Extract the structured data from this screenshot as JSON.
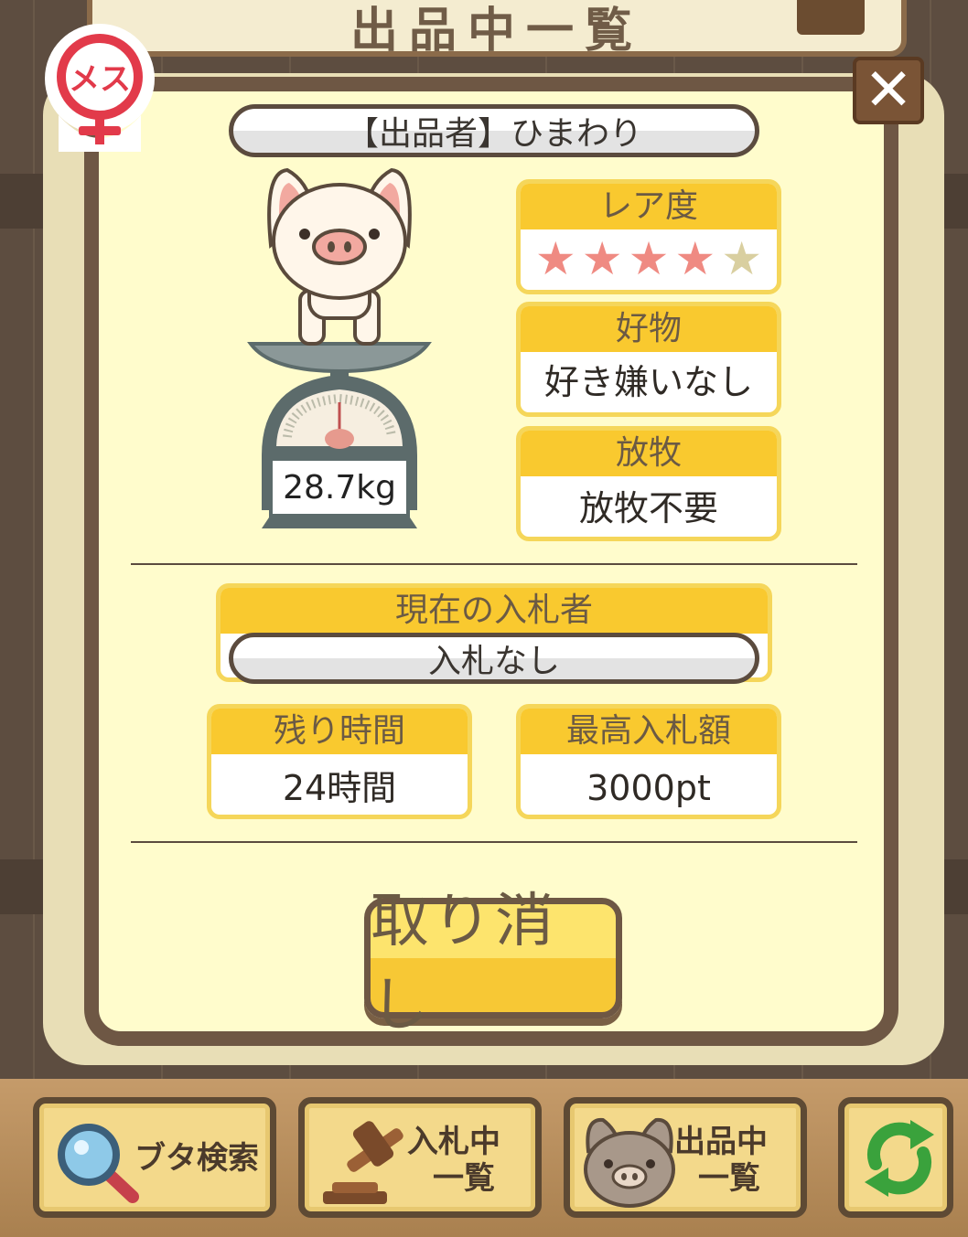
{
  "background": {
    "header_title": "出品中一覧"
  },
  "seller": {
    "label": "【出品者】ひまわり"
  },
  "gender": {
    "label": "メス"
  },
  "pig": {
    "weight": "28.7kg"
  },
  "rarity": {
    "title": "レア度",
    "stars_filled": 4,
    "stars_total": 5
  },
  "favorite": {
    "title": "好物",
    "value": "好き嫌いなし"
  },
  "grazing": {
    "title": "放牧",
    "value": "放牧不要"
  },
  "bidder": {
    "title": "現在の入札者",
    "value": "入札なし"
  },
  "remaining": {
    "title": "残り時間",
    "value": "24時間"
  },
  "highest_bid": {
    "title": "最高入札額",
    "value": "3000pt"
  },
  "cancel": {
    "label": "取り消し"
  },
  "toolbar": {
    "search_label": "ブタ検索",
    "bidding_line1": "入札中",
    "bidding_line2": "一覧",
    "listing_line1": "出品中",
    "listing_line2": "一覧"
  },
  "colors": {
    "accent_yellow": "#f9c92f",
    "frame_brown": "#6e5744",
    "panel": "#fffccc",
    "star": "#ef8a82",
    "female_red": "#e23a4a"
  }
}
